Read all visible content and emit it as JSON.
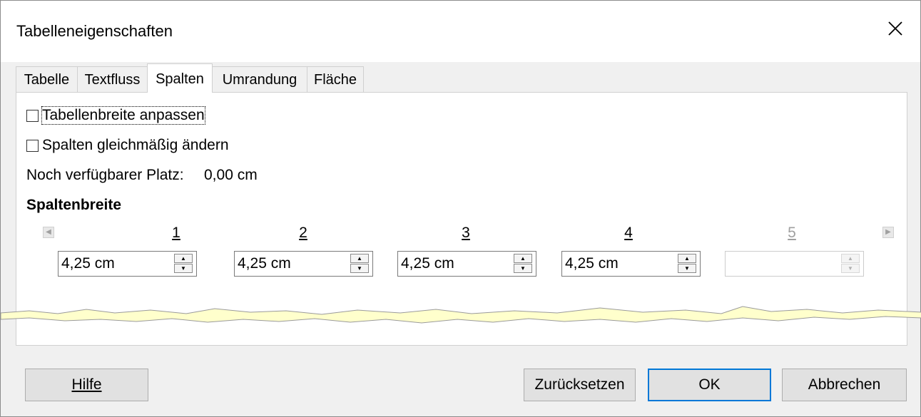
{
  "window": {
    "title": "Tabelleneigenschaften"
  },
  "tabs": [
    {
      "label": "Tabelle",
      "active": false
    },
    {
      "label": "Textfluss",
      "active": false
    },
    {
      "label": "Spalten",
      "active": true
    },
    {
      "label": "Umrandung",
      "active": false
    },
    {
      "label": "Fläche",
      "active": false
    }
  ],
  "options": {
    "adapt_width": {
      "label": "Tabellenbreite anpassen",
      "checked": false
    },
    "even_columns": {
      "label": "Spalten gleichmäßig ändern",
      "checked": false
    }
  },
  "remaining": {
    "label": "Noch verfügbarer Platz:",
    "value": "0,00 cm"
  },
  "section_heading": "Spaltenbreite",
  "columns": [
    {
      "number": "1",
      "value": "4,25 cm",
      "enabled": true
    },
    {
      "number": "2",
      "value": "4,25 cm",
      "enabled": true
    },
    {
      "number": "3",
      "value": "4,25 cm",
      "enabled": true
    },
    {
      "number": "4",
      "value": "4,25 cm",
      "enabled": true
    },
    {
      "number": "5",
      "value": "",
      "enabled": false
    }
  ],
  "buttons": {
    "help": "Hilfe",
    "reset": "Zurücksetzen",
    "ok": "OK",
    "cancel": "Abbrechen"
  },
  "colors": {
    "accent": "#0078d7",
    "tear_fill": "#ffffcc"
  }
}
